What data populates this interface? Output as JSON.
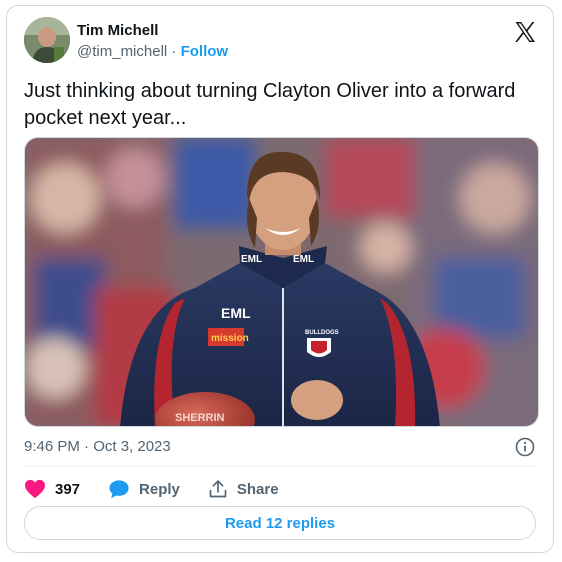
{
  "author": {
    "name": "Tim Michell",
    "handle": "@tim_michell",
    "separator": "·",
    "follow_label": "Follow"
  },
  "tweet": {
    "text": "Just thinking about turning Clayton Oliver into a forward pocket next year...",
    "timestamp": "9:46 PM · Oct 3, 2023"
  },
  "photo": {
    "jacket_brand_1": "EML",
    "jacket_brand_2": "EML",
    "jacket_brand_3": "EML",
    "sponsor": "mission",
    "club": "BULLDOGS",
    "ball_text": "SHERRIN"
  },
  "actions": {
    "likes_count": "397",
    "reply_label": "Reply",
    "share_label": "Share"
  },
  "replies_button": "Read 12 replies",
  "colors": {
    "accent": "#1d9bf0",
    "like": "#f91880",
    "muted": "#536471",
    "text": "#0f1419"
  },
  "icons": [
    "x-logo-icon",
    "info-icon",
    "heart-icon",
    "reply-bubble-icon",
    "share-icon"
  ]
}
